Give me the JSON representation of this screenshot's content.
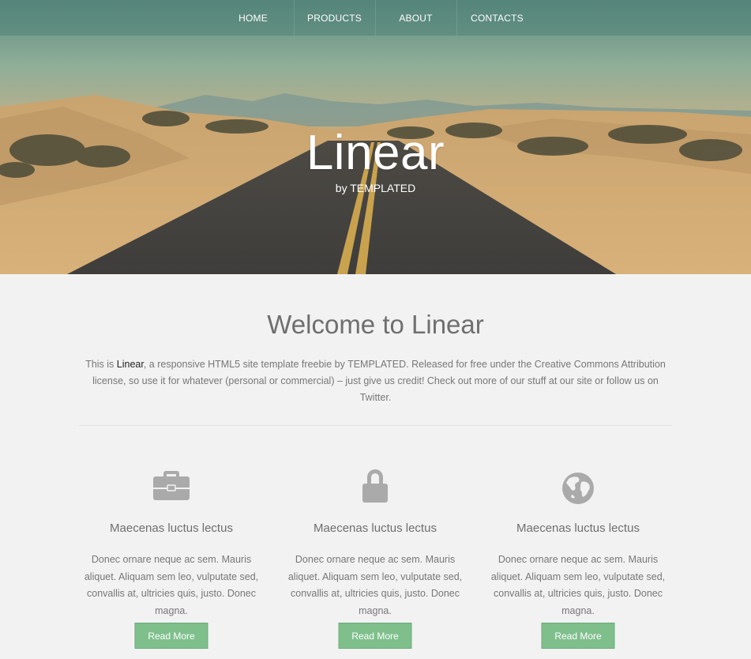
{
  "nav": {
    "items": [
      {
        "label": "HOME"
      },
      {
        "label": "PRODUCTS"
      },
      {
        "label": "ABOUT"
      },
      {
        "label": "CONTACTS"
      }
    ]
  },
  "hero": {
    "title": "Linear",
    "subtitle": "by TEMPLATED"
  },
  "welcome": {
    "title": "Welcome to Linear",
    "intro_before": "This is ",
    "intro_strong": "Linear",
    "intro_after": ", a responsive HTML5 site template freebie by TEMPLATED. Released for free under the Creative Commons Attribution license, so use it for whatever (personal or commercial) – just give us credit! Check out more of our stuff at our site or follow us on Twitter."
  },
  "features": [
    {
      "icon": "briefcase-icon",
      "title": "Maecenas luctus lectus",
      "text": "Donec ornare neque ac sem. Mauris aliquet. Aliquam sem leo, vulputate sed, convallis at, ultricies quis, justo. Donec magna.",
      "button": "Read More"
    },
    {
      "icon": "lock-icon",
      "title": "Maecenas luctus lectus",
      "text": "Donec ornare neque ac sem. Mauris aliquet. Aliquam sem leo, vulputate sed, convallis at, ultricies quis, justo. Donec magna.",
      "button": "Read More"
    },
    {
      "icon": "globe-icon",
      "title": "Maecenas luctus lectus",
      "text": "Donec ornare neque ac sem. Mauris aliquet. Aliquam sem leo, vulputate sed, convallis at, ultricies quis, justo. Donec magna.",
      "button": "Read More"
    }
  ],
  "colors": {
    "accent_button": "#7fbf8c",
    "background": "#f2f2f2",
    "icon": "#aaaaaa",
    "nav_bar": "#5a8a80"
  }
}
